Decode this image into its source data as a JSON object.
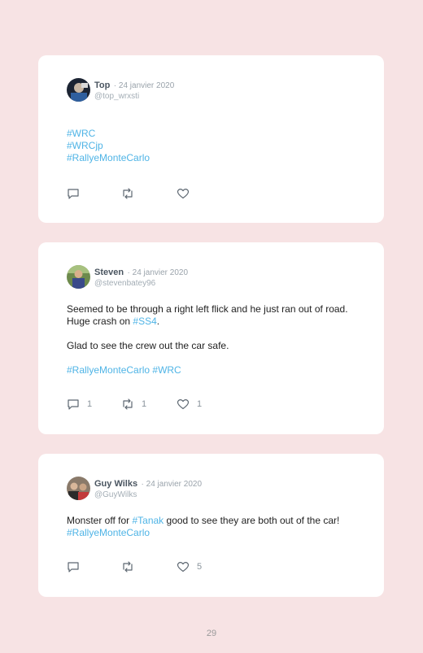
{
  "tweets": [
    {
      "name": "Top",
      "date": "· 24 janvier 2020",
      "handle": "@top_wrxsti",
      "lines": [
        "#WRC",
        "#WRCjp",
        "#RallyeMonteCarlo"
      ],
      "comments": "",
      "retweets": "",
      "likes": ""
    },
    {
      "name": "Steven",
      "date": "· 24 janvier 2020",
      "handle": "@stevenbatey96",
      "text1a": "Seemed to be through a right left flick and he just ran out of road. Huge crash on ",
      "text1tag": "#SS4",
      "text1b": ".",
      "text2": "Glad to see the crew out the car safe.",
      "tag3a": "#RallyeMonteCarlo",
      "tag3b": "#WRC",
      "comments": "1",
      "retweets": "1",
      "likes": "1"
    },
    {
      "name": "Guy Wilks",
      "date": "· 24 janvier 2020",
      "handle": "@GuyWilks",
      "texta": "Monster off for ",
      "taga": "#Tanak",
      "textb": " good to see they are both out of the car! ",
      "tagb": "#RallyeMonteCarlo",
      "comments": "",
      "retweets": "",
      "likes": "5"
    }
  ],
  "colors": {
    "background": "#f7e3e4",
    "card": "#ffffff",
    "hashtag": "#4fb4e6",
    "icon": "#5c6670"
  },
  "icons": [
    "comment-icon",
    "retweet-icon",
    "heart-icon"
  ],
  "page_number": "29"
}
